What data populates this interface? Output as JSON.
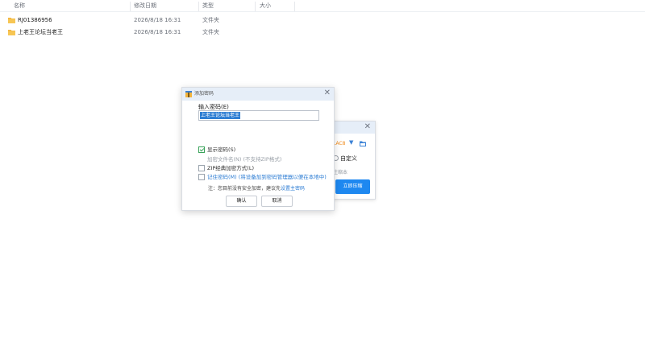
{
  "explorer": {
    "columns": [
      "名称",
      "修改日期",
      "类型",
      "大小"
    ],
    "rows": [
      {
        "name": "RJ01386956",
        "date": "2026/8/18 16:31",
        "type": "文件夹"
      },
      {
        "name": "上老王论坛当老王",
        "date": "2026/8/18 16:31",
        "type": "文件夹"
      }
    ]
  },
  "bg_dialog": {
    "combo_text": "LAC8",
    "radio_label": "自定义",
    "hint": "注缩本",
    "primary_button": "立即压缩"
  },
  "dialog": {
    "title": "添加密码",
    "password_label": "输入密码(E)",
    "password_value": "上老王论坛当老王",
    "options": [
      {
        "label": "显示密码(S)",
        "checked": true,
        "state": "normal"
      },
      {
        "label": "加密文件名(N) (不支持ZIP格式)",
        "checked": false,
        "state": "disabled"
      },
      {
        "label": "ZIP经典加密方式(L)",
        "checked": false,
        "state": "normal"
      },
      {
        "label": "记住密码(M) (将设备加到密码管理器以便在本地中)",
        "checked": false,
        "state": "link"
      }
    ],
    "note_prefix": "注：",
    "note_text": "您目前没有安全加密，建议先",
    "note_link": "设置主密码",
    "ok_label": "确认",
    "cancel_label": "取消"
  },
  "colors": {
    "accent": "#1e88f0",
    "title_bar": "#e6eef8",
    "link": "#2a7bd3",
    "check": "#3aa35a"
  }
}
